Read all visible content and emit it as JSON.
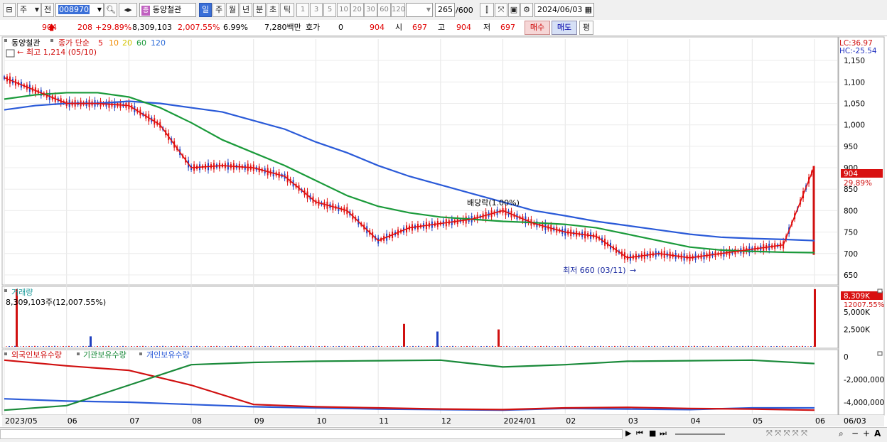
{
  "toolbar": {
    "market_type": "주",
    "prev_label": "전",
    "code": "008970",
    "stock_name": "동양철관",
    "period_tabs": [
      {
        "label": "일",
        "selected": true
      },
      {
        "label": "주",
        "selected": false
      },
      {
        "label": "월",
        "selected": false
      },
      {
        "label": "년",
        "selected": false
      },
      {
        "label": "분",
        "selected": false
      },
      {
        "label": "초",
        "selected": false
      },
      {
        "label": "틱",
        "selected": false
      }
    ],
    "interval_buttons": [
      "1",
      "3",
      "5",
      "10",
      "20",
      "30",
      "60",
      "120"
    ],
    "count_value": "265",
    "count_total": "/600",
    "date_value": "2024/06/03"
  },
  "quote": {
    "price": "904",
    "change": "208",
    "change_rate": "+29.89%",
    "volume": "8,309,103",
    "volume_ratio": "2,007.55%",
    "turnover": "6.99%",
    "amount": "7,280백만",
    "hoga_label": "호가",
    "hoga_value": "0",
    "hoga_price": "904",
    "open_label": "시",
    "open": "697",
    "high_label": "고",
    "high": "904",
    "low_label": "저",
    "low": "697",
    "buy_label": "매수",
    "sell_label": "매도",
    "avg_label": "평"
  },
  "price_panel": {
    "stock_label": "동양철관",
    "ma_label": "종가 단순",
    "ma_periods": [
      {
        "label": "5",
        "color": "#e01010"
      },
      {
        "label": "10",
        "color": "#f08a00"
      },
      {
        "label": "20",
        "color": "#e6d800"
      },
      {
        "label": "60",
        "color": "#1a9a3a"
      },
      {
        "label": "120",
        "color": "#2a6ad8"
      }
    ],
    "high_annotation": "최고 1,214 (05/10)",
    "low_annotation": "최저 660 (03/11)",
    "dividend_annotation": "배당락(1.00%)",
    "lc_label": "LC:36.97",
    "hc_label": "HC:-25.54",
    "current_price_tag": "904",
    "current_rate_tag": "29.89%",
    "y_ticks": [
      "1,150",
      "1,100",
      "1,050",
      "1,000",
      "950",
      "900",
      "850",
      "800",
      "750",
      "700",
      "650"
    ]
  },
  "volume_panel": {
    "title": "거래량",
    "value_text": "8,309,103주(12,007.55%)",
    "current_tag": "8,309K",
    "current_rate": "12007.55%",
    "y_ticks": [
      "5,000K",
      "2,500K"
    ]
  },
  "holding_panel": {
    "series_labels": [
      {
        "label": "외국인보유수량",
        "color": "#d01010"
      },
      {
        "label": "기관보유수량",
        "color": "#1a8a3a"
      },
      {
        "label": "개인보유수량",
        "color": "#2a5ad8"
      }
    ],
    "y_ticks": [
      "0",
      "-2,000,000",
      "-4,000,000"
    ]
  },
  "x_axis": {
    "labels": [
      "2023/05",
      "06",
      "07",
      "08",
      "09",
      "10",
      "11",
      "12",
      "2024/01",
      "02",
      "03",
      "04",
      "05",
      "06"
    ],
    "right_label": "06/03"
  },
  "chart_data": {
    "type": "line",
    "title": "동양철관",
    "price_ylim": [
      630,
      1200
    ],
    "months": [
      "2023/05",
      "06",
      "07",
      "08",
      "09",
      "10",
      "11",
      "12",
      "2024/01",
      "02",
      "03",
      "04",
      "05",
      "06"
    ],
    "ma_close": {
      "x_month_index": [
        0,
        0.5,
        1,
        1.5,
        2,
        2.5,
        3,
        3.5,
        4,
        4.5,
        5,
        5.5,
        6,
        6.5,
        7,
        7.5,
        8,
        8.5,
        9,
        9.5,
        10,
        10.5,
        11,
        11.5,
        12,
        12.5,
        13
      ],
      "ma5": [
        1110,
        1080,
        1050,
        1050,
        1045,
        1000,
        900,
        905,
        900,
        880,
        820,
        800,
        730,
        760,
        770,
        780,
        800,
        770,
        750,
        740,
        690,
        700,
        690,
        700,
        710,
        720,
        904
      ],
      "ma120": [
        1035,
        1045,
        1050,
        1050,
        1055,
        1050,
        1040,
        1030,
        1010,
        990,
        960,
        935,
        905,
        880,
        860,
        840,
        820,
        800,
        788,
        775,
        765,
        755,
        745,
        738,
        735,
        733,
        730
      ],
      "ma60": [
        1060,
        1070,
        1075,
        1075,
        1065,
        1040,
        1005,
        965,
        935,
        905,
        870,
        835,
        810,
        795,
        785,
        780,
        775,
        772,
        768,
        760,
        745,
        730,
        715,
        708,
        705,
        703,
        702
      ]
    },
    "volume_k": {
      "spikes": [
        {
          "date": "2023/05/10",
          "value": 8309
        },
        {
          "date": "2023/06/20",
          "value": 1500
        },
        {
          "date": "2023/11/20",
          "value": 3300
        },
        {
          "date": "2023/12/01",
          "value": 2200
        },
        {
          "date": "2023/12/20",
          "value": 2500
        },
        {
          "date": "2024/06/03",
          "value": 8309
        }
      ],
      "ylim": [
        0,
        8500
      ]
    },
    "holdings": {
      "foreign": [
        -300000,
        -800000,
        -1200000,
        -2500000,
        -4200000,
        -4400000,
        -4500000,
        -4600000,
        -4650000,
        -4500000,
        -4450000,
        -4550000,
        -4600000,
        -4700000
      ],
      "institution": [
        -4700000,
        -4300000,
        -2500000,
        -700000,
        -500000,
        -400000,
        -350000,
        -300000,
        -900000,
        -700000,
        -400000,
        -350000,
        -300000,
        -600000
      ],
      "individual": [
        -3700000,
        -3900000,
        -4000000,
        -4200000,
        -4400000,
        -4500000,
        -4600000,
        -4650000,
        -4700000,
        -4550000,
        -4600000,
        -4650000,
        -4500000,
        -4500000
      ],
      "ylim": [
        -5000000,
        500000
      ]
    }
  }
}
